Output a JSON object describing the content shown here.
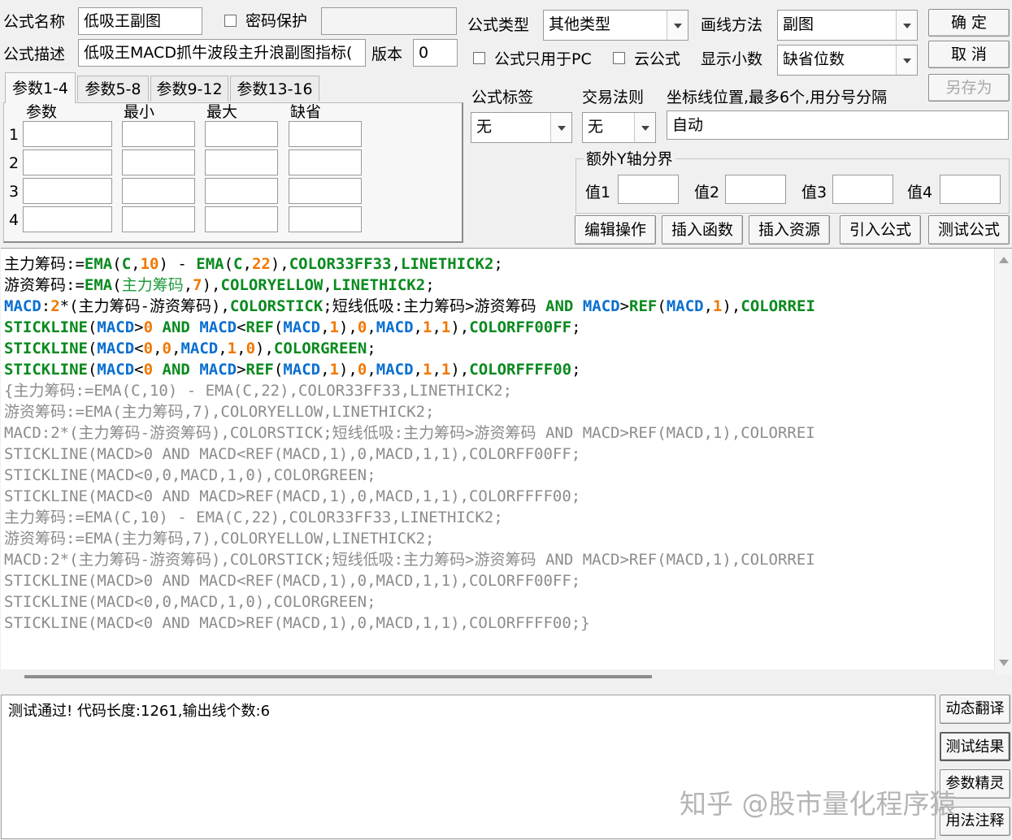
{
  "header": {
    "name_label": "公式名称",
    "name_value": "低吸王副图",
    "password_label": "密码保护",
    "desc_label": "公式描述",
    "desc_value": "低吸王MACD抓牛波段主升浪副图指标(",
    "version_label": "版本",
    "version_value": "0",
    "type_label": "公式类型",
    "type_value": "其他类型",
    "draw_label": "画线方法",
    "draw_value": "副图",
    "pc_only_label": "公式只用于PC",
    "cloud_label": "云公式",
    "decimals_label": "显示小数",
    "decimals_value": "缺省位数"
  },
  "buttons": {
    "ok": "确  定",
    "cancel": "取  消",
    "save_as": "另存为",
    "edit_ops": "编辑操作",
    "insert_func": "插入函数",
    "insert_res": "插入资源",
    "import_formula": "引入公式",
    "test_formula": "测试公式",
    "dynamic_translate": "动态翻译",
    "test_result": "测试结果",
    "param_wizard": "参数精灵",
    "usage_notes": "用法注释"
  },
  "tabs": [
    "参数1-4",
    "参数5-8",
    "参数9-12",
    "参数13-16"
  ],
  "params": {
    "headers": [
      "参数",
      "最小",
      "最大",
      "缺省"
    ],
    "rows": [
      "1",
      "2",
      "3",
      "4"
    ]
  },
  "tags": {
    "tag_label": "公式标签",
    "tag_value": "无",
    "rule_label": "交易法则",
    "rule_value": "无",
    "axis_label": "坐标线位置,最多6个,用分号分隔",
    "axis_value": "自动",
    "extra_y_label": "额外Y轴分界",
    "v1": "值1",
    "v2": "值2",
    "v3": "值3",
    "v4": "值4"
  },
  "code": {
    "active": [
      [
        [
          "id",
          "主力筹码"
        ],
        [
          "txt",
          ":="
        ],
        [
          "fn",
          "EMA"
        ],
        [
          "txt",
          "("
        ],
        [
          "fn",
          "C"
        ],
        [
          "txt",
          ","
        ],
        [
          "num",
          "10"
        ],
        [
          "txt",
          ") - "
        ],
        [
          "fn",
          "EMA"
        ],
        [
          "txt",
          "("
        ],
        [
          "fn",
          "C"
        ],
        [
          "txt",
          ","
        ],
        [
          "num",
          "22"
        ],
        [
          "txt",
          "),"
        ],
        [
          "fn",
          "COLOR33FF33"
        ],
        [
          "txt",
          ","
        ],
        [
          "fn",
          "LINETHICK2"
        ],
        [
          "txt",
          ";"
        ]
      ],
      [
        [
          "id",
          "游资筹码"
        ],
        [
          "txt",
          ":="
        ],
        [
          "fn",
          "EMA"
        ],
        [
          "txt",
          "("
        ],
        [
          "green",
          "主力筹码"
        ],
        [
          "txt",
          ","
        ],
        [
          "num",
          "7"
        ],
        [
          "txt",
          "),"
        ],
        [
          "fn",
          "COLORYELLOW"
        ],
        [
          "txt",
          ","
        ],
        [
          "fn",
          "LINETHICK2"
        ],
        [
          "txt",
          ";"
        ]
      ],
      [
        [
          "out",
          "MACD"
        ],
        [
          "txt",
          ":"
        ],
        [
          "num",
          "2"
        ],
        [
          "txt",
          "*(主力筹码-游资筹码),"
        ],
        [
          "fn",
          "COLORSTICK"
        ],
        [
          "txt",
          ";短线低吸:主力筹码>游资筹码 "
        ],
        [
          "fn",
          "AND"
        ],
        [
          "txt",
          " "
        ],
        [
          "out",
          "MACD"
        ],
        [
          "txt",
          ">"
        ],
        [
          "fn",
          "REF"
        ],
        [
          "txt",
          "("
        ],
        [
          "out",
          "MACD"
        ],
        [
          "txt",
          ","
        ],
        [
          "num",
          "1"
        ],
        [
          "txt",
          "),"
        ],
        [
          "fn",
          "COLORREI"
        ]
      ],
      [
        [
          "fn",
          "STICKLINE"
        ],
        [
          "txt",
          "("
        ],
        [
          "out",
          "MACD"
        ],
        [
          "txt",
          ">"
        ],
        [
          "num",
          "0"
        ],
        [
          "txt",
          " "
        ],
        [
          "fn",
          "AND"
        ],
        [
          "txt",
          " "
        ],
        [
          "out",
          "MACD"
        ],
        [
          "txt",
          "<"
        ],
        [
          "fn",
          "REF"
        ],
        [
          "txt",
          "("
        ],
        [
          "out",
          "MACD"
        ],
        [
          "txt",
          ","
        ],
        [
          "num",
          "1"
        ],
        [
          "txt",
          "),"
        ],
        [
          "num",
          "0"
        ],
        [
          "txt",
          ","
        ],
        [
          "out",
          "MACD"
        ],
        [
          "txt",
          ","
        ],
        [
          "num",
          "1"
        ],
        [
          "txt",
          ","
        ],
        [
          "num",
          "1"
        ],
        [
          "txt",
          "),"
        ],
        [
          "fn",
          "COLORFF00FF"
        ],
        [
          "txt",
          ";"
        ]
      ],
      [
        [
          "fn",
          "STICKLINE"
        ],
        [
          "txt",
          "("
        ],
        [
          "out",
          "MACD"
        ],
        [
          "txt",
          "<"
        ],
        [
          "num",
          "0"
        ],
        [
          "txt",
          ","
        ],
        [
          "num",
          "0"
        ],
        [
          "txt",
          ","
        ],
        [
          "out",
          "MACD"
        ],
        [
          "txt",
          ","
        ],
        [
          "num",
          "1"
        ],
        [
          "txt",
          ","
        ],
        [
          "num",
          "0"
        ],
        [
          "txt",
          "),"
        ],
        [
          "fn",
          "COLORGREEN"
        ],
        [
          "txt",
          ";"
        ]
      ],
      [
        [
          "fn",
          "STICKLINE"
        ],
        [
          "txt",
          "("
        ],
        [
          "out",
          "MACD"
        ],
        [
          "txt",
          "<"
        ],
        [
          "num",
          "0"
        ],
        [
          "txt",
          " "
        ],
        [
          "fn",
          "AND"
        ],
        [
          "txt",
          " "
        ],
        [
          "out",
          "MACD"
        ],
        [
          "txt",
          ">"
        ],
        [
          "fn",
          "REF"
        ],
        [
          "txt",
          "("
        ],
        [
          "out",
          "MACD"
        ],
        [
          "txt",
          ","
        ],
        [
          "num",
          "1"
        ],
        [
          "txt",
          "),"
        ],
        [
          "num",
          "0"
        ],
        [
          "txt",
          ","
        ],
        [
          "out",
          "MACD"
        ],
        [
          "txt",
          ","
        ],
        [
          "num",
          "1"
        ],
        [
          "txt",
          ","
        ],
        [
          "num",
          "1"
        ],
        [
          "txt",
          "),"
        ],
        [
          "fn",
          "COLORFFFF00"
        ],
        [
          "txt",
          ";"
        ]
      ]
    ],
    "comment": [
      "{主力筹码:=EMA(C,10) - EMA(C,22),COLOR33FF33,LINETHICK2;",
      "游资筹码:=EMA(主力筹码,7),COLORYELLOW,LINETHICK2;",
      "MACD:2*(主力筹码-游资筹码),COLORSTICK;短线低吸:主力筹码>游资筹码 AND MACD>REF(MACD,1),COLORREI",
      "STICKLINE(MACD>0 AND MACD<REF(MACD,1),0,MACD,1,1),COLORFF00FF;",
      "STICKLINE(MACD<0,0,MACD,1,0),COLORGREEN;",
      "STICKLINE(MACD<0 AND MACD>REF(MACD,1),0,MACD,1,1),COLORFFFF00;",
      "主力筹码:=EMA(C,10) - EMA(C,22),COLOR33FF33,LINETHICK2;",
      "游资筹码:=EMA(主力筹码,7),COLORYELLOW,LINETHICK2;",
      "MACD:2*(主力筹码-游资筹码),COLORSTICK;短线低吸:主力筹码>游资筹码 AND MACD>REF(MACD,1),COLORREI",
      "STICKLINE(MACD>0 AND MACD<REF(MACD,1),0,MACD,1,1),COLORFF00FF;",
      "STICKLINE(MACD<0,0,MACD,1,0),COLORGREEN;",
      "STICKLINE(MACD<0 AND MACD>REF(MACD,1),0,MACD,1,1),COLORFFFF00;}"
    ]
  },
  "output": {
    "message": "测试通过! 代码长度:1261,输出线个数:6"
  },
  "watermark": "知乎 @股市量化程序猿"
}
